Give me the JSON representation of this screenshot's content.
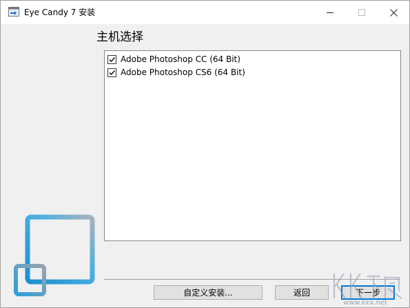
{
  "window": {
    "title": "Eye Candy 7 安装",
    "controls": {
      "minimize": "—",
      "maximize": "☐",
      "close": "✕"
    }
  },
  "page": {
    "heading": "主机选择"
  },
  "hosts": [
    {
      "label": "Adobe Photoshop CC (64 Bit)",
      "checked": true
    },
    {
      "label": "Adobe Photoshop CS6 (64 Bit)",
      "checked": true
    }
  ],
  "buttons": {
    "custom_install": "自定义安装...",
    "back": "返回",
    "next": "下一步"
  },
  "watermark": {
    "brand": "KK下载",
    "url": "www.kkx.net"
  },
  "colors": {
    "accent": "#0078d7",
    "logo_blue": "#2e9fd8",
    "logo_gray": "#9aa3ad"
  }
}
